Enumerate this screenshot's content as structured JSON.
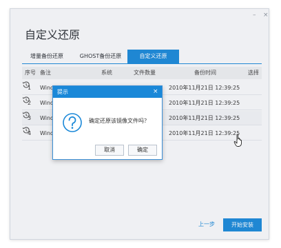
{
  "window": {
    "title": "自定义还原",
    "minimize_glyph": "–",
    "close_glyph": "×"
  },
  "tabs": [
    {
      "label": "增量备份还原",
      "active": false
    },
    {
      "label": "GHOST备份还原",
      "active": false
    },
    {
      "label": "自定义还原",
      "active": true
    }
  ],
  "table": {
    "headers": [
      "序号",
      "备注",
      "系统",
      "文件数量",
      "备份时间",
      "选择"
    ],
    "rows": [
      {
        "num": "1",
        "note": "Wind",
        "time": "2010年11月21日 12:39:25",
        "action_icon": "restore-icon"
      },
      {
        "num": "2",
        "note": "Wind",
        "time": "2010年11月21日 12:39:25",
        "action_icon": "restore-icon"
      },
      {
        "num": "3",
        "note": "Wind",
        "time": "2010年11月21日 12:39:25",
        "action_icon": "restore-icon"
      },
      {
        "num": "4",
        "note": "Wind",
        "time": "2010年11月21日 12:39:25",
        "action_icon": "restore-icon"
      }
    ]
  },
  "dialog": {
    "title": "提示",
    "close_glyph": "×",
    "message": "确定还原该镜像文件吗？",
    "cancel_label": "取消",
    "ok_label": "确定",
    "icon": "question-icon"
  },
  "footer": {
    "back_label": "上一步",
    "install_label": "开始安装"
  },
  "colors": {
    "accent": "#1a88d8",
    "window_bg": "#f7f8fa",
    "header_bg": "#ebedf0"
  }
}
